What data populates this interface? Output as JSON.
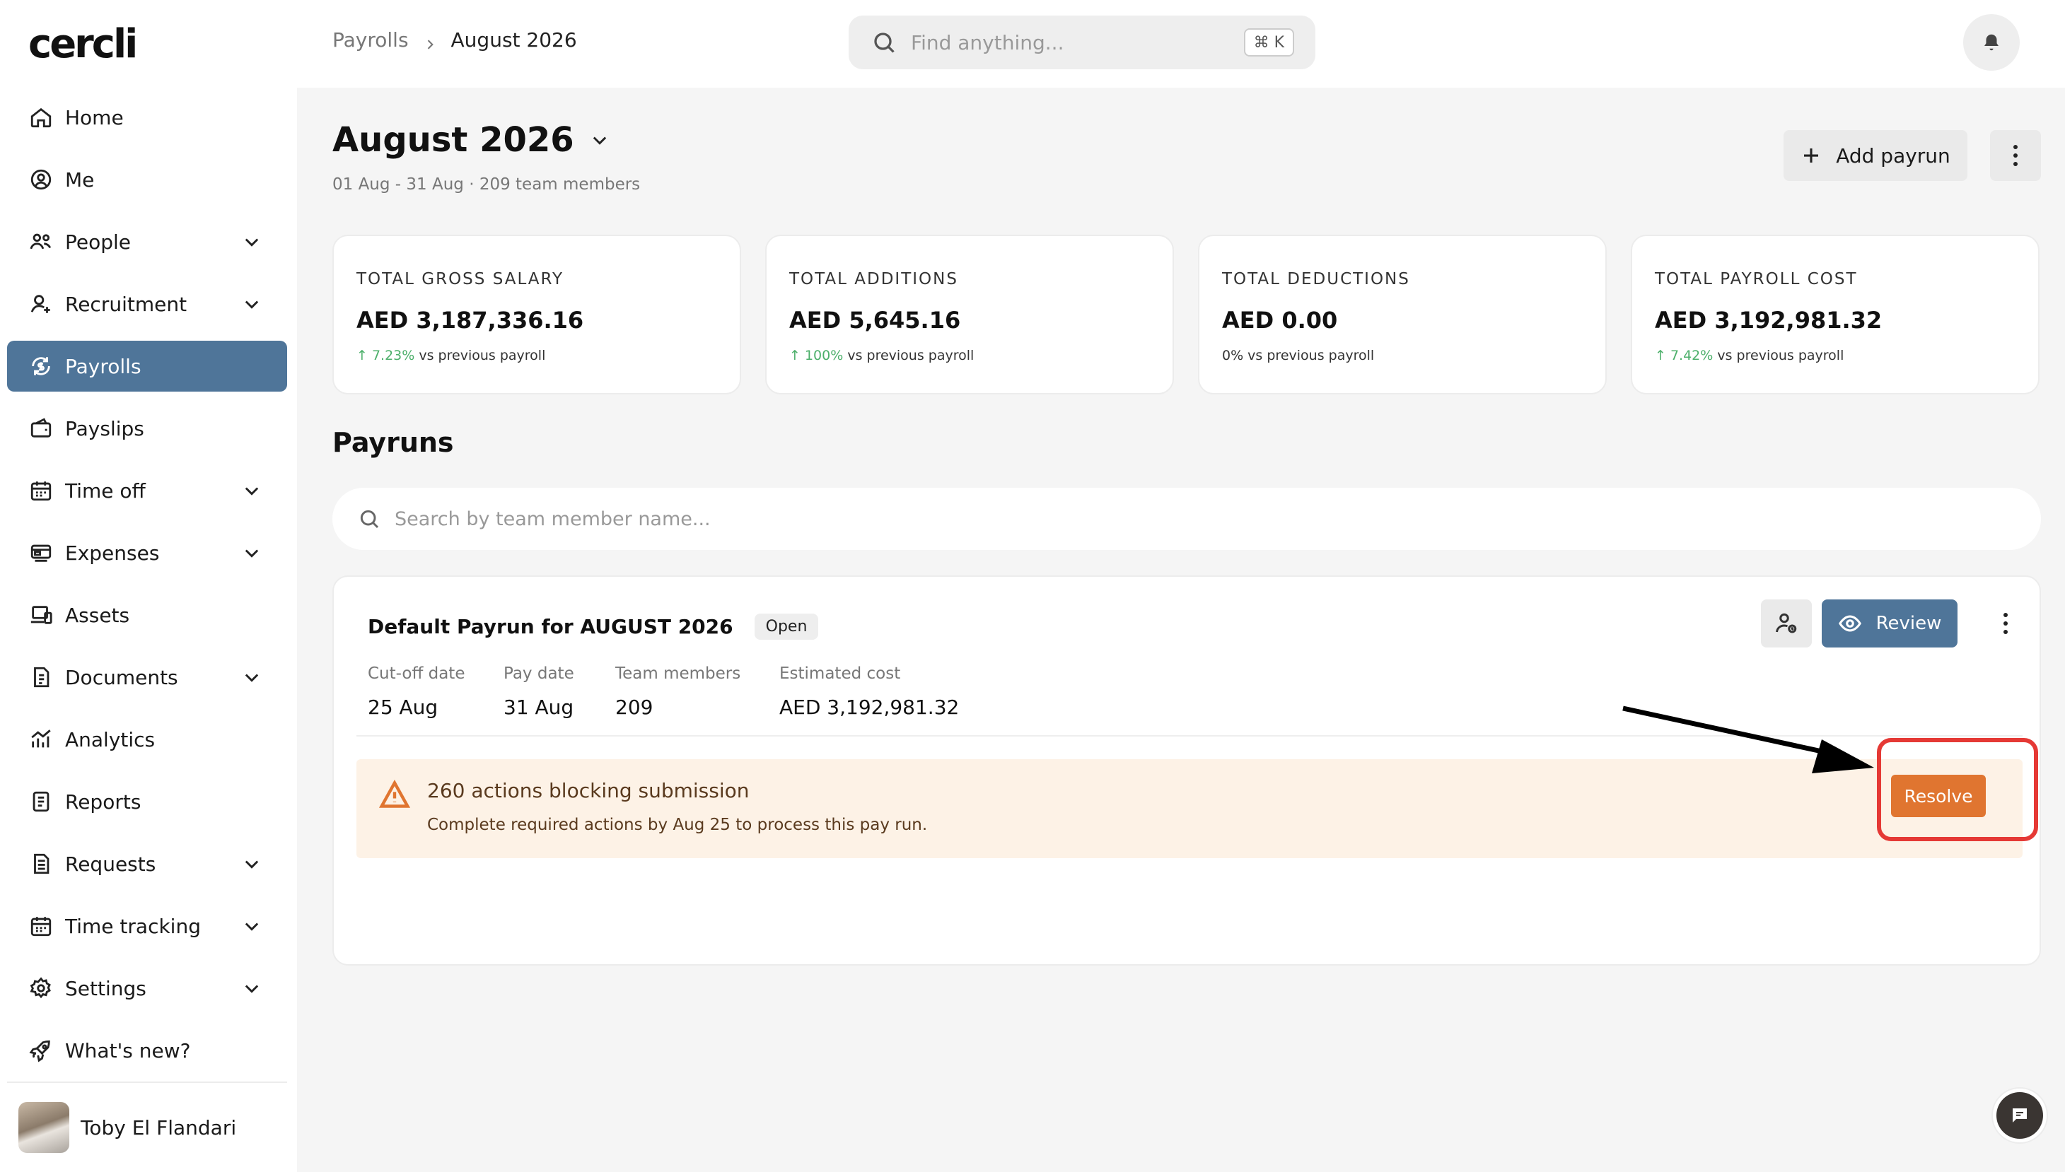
{
  "app": {
    "logo": "cercli"
  },
  "sidebar": {
    "items": [
      {
        "key": "home",
        "label": "Home",
        "icon": "home-icon",
        "chevron": false,
        "active": false
      },
      {
        "key": "me",
        "label": "Me",
        "icon": "user-circle-icon",
        "chevron": false,
        "active": false
      },
      {
        "key": "people",
        "label": "People",
        "icon": "people-icon",
        "chevron": true,
        "active": false
      },
      {
        "key": "recruitment",
        "label": "Recruitment",
        "icon": "user-add-icon",
        "chevron": true,
        "active": false
      },
      {
        "key": "payrolls",
        "label": "Payrolls",
        "icon": "payroll-icon",
        "chevron": false,
        "active": true
      },
      {
        "key": "payslips",
        "label": "Payslips",
        "icon": "wallet-icon",
        "chevron": false,
        "active": false
      },
      {
        "key": "time-off",
        "label": "Time off",
        "icon": "calendar-icon",
        "chevron": true,
        "active": false
      },
      {
        "key": "expenses",
        "label": "Expenses",
        "icon": "card-icon",
        "chevron": true,
        "active": false
      },
      {
        "key": "assets",
        "label": "Assets",
        "icon": "devices-icon",
        "chevron": false,
        "active": false
      },
      {
        "key": "documents",
        "label": "Documents",
        "icon": "document-icon",
        "chevron": true,
        "active": false
      },
      {
        "key": "analytics",
        "label": "Analytics",
        "icon": "analytics-icon",
        "chevron": false,
        "active": false
      },
      {
        "key": "reports",
        "label": "Reports",
        "icon": "report-icon",
        "chevron": false,
        "active": false
      },
      {
        "key": "requests",
        "label": "Requests",
        "icon": "request-icon",
        "chevron": true,
        "active": false
      },
      {
        "key": "time-tracking",
        "label": "Time tracking",
        "icon": "calendar-clock-icon",
        "chevron": true,
        "active": false
      },
      {
        "key": "settings",
        "label": "Settings",
        "icon": "gear-icon",
        "chevron": true,
        "active": false
      },
      {
        "key": "whats-new",
        "label": "What's new?",
        "icon": "rocket-icon",
        "chevron": false,
        "active": false
      }
    ],
    "user": {
      "name": "Toby El Flandari"
    }
  },
  "topbar": {
    "breadcrumb": {
      "parent": "Payrolls",
      "current": "August 2026"
    },
    "search": {
      "placeholder": "Find anything...",
      "shortcut": "⌘ K"
    }
  },
  "header": {
    "title": "August 2026",
    "subtitle": "01 Aug - 31 Aug · 209 team members",
    "add_label": "Add payrun"
  },
  "stats": [
    {
      "label": "TOTAL GROSS SALARY",
      "value": "AED 3,187,336.16",
      "change": "↑ 7.23%",
      "change_suffix": " vs previous payroll"
    },
    {
      "label": "TOTAL ADDITIONS",
      "value": "AED 5,645.16",
      "change": "↑ 100%",
      "change_suffix": " vs previous payroll"
    },
    {
      "label": "TOTAL DEDUCTIONS",
      "value": "AED 0.00",
      "change": "",
      "change_suffix": "0% vs previous payroll"
    },
    {
      "label": "TOTAL PAYROLL COST",
      "value": "AED 3,192,981.32",
      "change": "↑ 7.42%",
      "change_suffix": " vs previous payroll"
    }
  ],
  "payruns": {
    "title": "Payruns",
    "search_placeholder": "Search by team member name...",
    "card": {
      "title": "Default Payrun for AUGUST 2026",
      "status": "Open",
      "review_label": "Review",
      "meta": [
        {
          "label": "Cut-off date",
          "value": "25 Aug"
        },
        {
          "label": "Pay date",
          "value": "31 Aug"
        },
        {
          "label": "Team members",
          "value": "209"
        },
        {
          "label": "Estimated cost",
          "value": "AED 3,192,981.32"
        }
      ],
      "alert": {
        "title": "260 actions blocking submission",
        "subtitle": "Complete required actions by Aug 25 to process this pay run.",
        "action_label": "Resolve"
      }
    }
  },
  "colors": {
    "accent": "#4f7599",
    "warning": "#e07530",
    "alert_bg": "#fdf2e6",
    "positive": "#4caf6a",
    "annotation": "#e53935"
  }
}
